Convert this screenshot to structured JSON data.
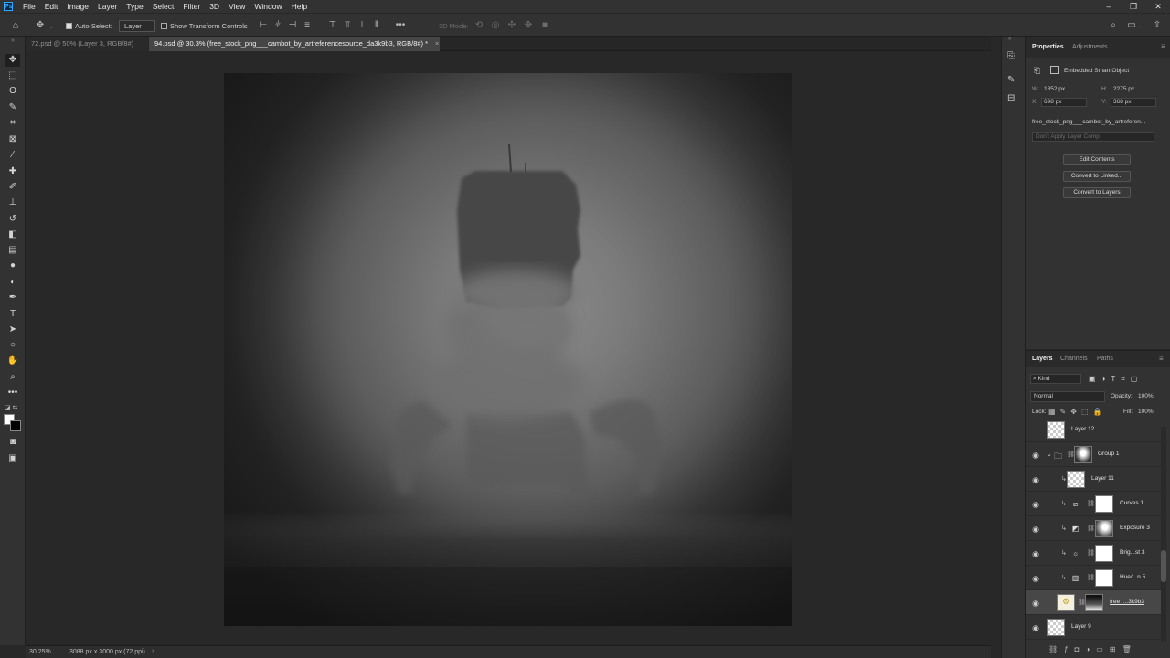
{
  "menu": [
    "File",
    "Edit",
    "Image",
    "Layer",
    "Type",
    "Select",
    "Filter",
    "3D",
    "View",
    "Window",
    "Help"
  ],
  "options": {
    "auto_select_label": "Auto-Select:",
    "auto_select_target": "Layer",
    "transform_controls_label": "Show Transform Controls",
    "mode_3d_label": "3D Mode:"
  },
  "tabs": [
    {
      "label": "72.psd @ 50% (Layer 3, RGB/8#)",
      "active": false
    },
    {
      "label": "94.psd @ 30.3% (free_stock_png___cambot_by_artreferencesource_da3k9b3, RGB/8#) *",
      "active": true
    }
  ],
  "status": {
    "zoom": "30.25%",
    "doc_info": "3088 px x 3000 px (72 ppi)"
  },
  "properties": {
    "tab_properties": "Properties",
    "tab_adjustments": "Adjustments",
    "type": "Embedded Smart Object",
    "w_label": "W:",
    "w_value": "1852 px",
    "h_label": "H:",
    "h_value": "2275 px",
    "x_label": "X:",
    "x_value": "698 px",
    "y_label": "Y:",
    "y_value": "368 px",
    "filename": "free_stock_png___cambot_by_artreferen...",
    "layer_comp": "Don't Apply Layer Comp",
    "btn_edit": "Edit Contents",
    "btn_convert_linked": "Convert to Linked...",
    "btn_convert_layers": "Convert to Layers"
  },
  "layers_panel": {
    "tab_layers": "Layers",
    "tab_channels": "Channels",
    "tab_paths": "Paths",
    "kind_label": "Kind",
    "blend_mode": "Normal",
    "opacity_label": "Opacity:",
    "opacity_value": "100%",
    "lock_label": "Lock:",
    "fill_label": "Fill:",
    "fill_value": "100%",
    "rows": [
      {
        "name": "Layer 12",
        "visible": false
      },
      {
        "name": "Group 1",
        "visible": true
      },
      {
        "name": "Layer 11",
        "visible": true
      },
      {
        "name": "Curves 1",
        "visible": true
      },
      {
        "name": "Exposure 3",
        "visible": true
      },
      {
        "name": "Brig...st 3",
        "visible": true
      },
      {
        "name": "Hue/...n 5",
        "visible": true
      },
      {
        "name": "free_...3k9b3",
        "visible": true
      },
      {
        "name": "Layer 9",
        "visible": true
      }
    ]
  },
  "colors": {
    "accent": "#31a8ff",
    "panel": "#323232",
    "canvas_bg": "#282828"
  }
}
